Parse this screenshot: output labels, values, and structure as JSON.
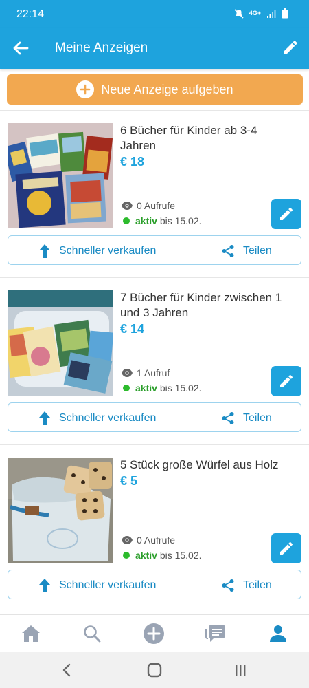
{
  "status_bar": {
    "time": "22:14",
    "network": "4G+"
  },
  "app_bar": {
    "title": "Meine Anzeigen"
  },
  "new_ad": {
    "label": "Neue Anzeige aufgeben"
  },
  "listings": [
    {
      "title": "6 Bücher für Kinder ab 3-4 Jahren",
      "price": "€ 18",
      "views": "0 Aufrufe",
      "status": "aktiv",
      "until": "bis 15.02.",
      "sell_label": "Schneller verkaufen",
      "share_label": "Teilen"
    },
    {
      "title": "7 Bücher für Kinder zwischen 1 und 3 Jahren",
      "price": "€ 14",
      "views": "1 Aufruf",
      "status": "aktiv",
      "until": "bis 15.02.",
      "sell_label": "Schneller verkaufen",
      "share_label": "Teilen"
    },
    {
      "title": "5 Stück große Würfel aus Holz",
      "price": "€ 5",
      "views": "0 Aufrufe",
      "status": "aktiv",
      "until": "bis 15.02.",
      "sell_label": "Schneller verkaufen",
      "share_label": "Teilen"
    }
  ],
  "bottom_nav": {
    "items": [
      "home-icon",
      "search-icon",
      "add-icon",
      "messages-icon",
      "profile-icon"
    ],
    "active": "profile-icon"
  },
  "colors": {
    "primary": "#1ea3dd",
    "accent": "#f2a850",
    "active_status": "#2dbb2d"
  }
}
